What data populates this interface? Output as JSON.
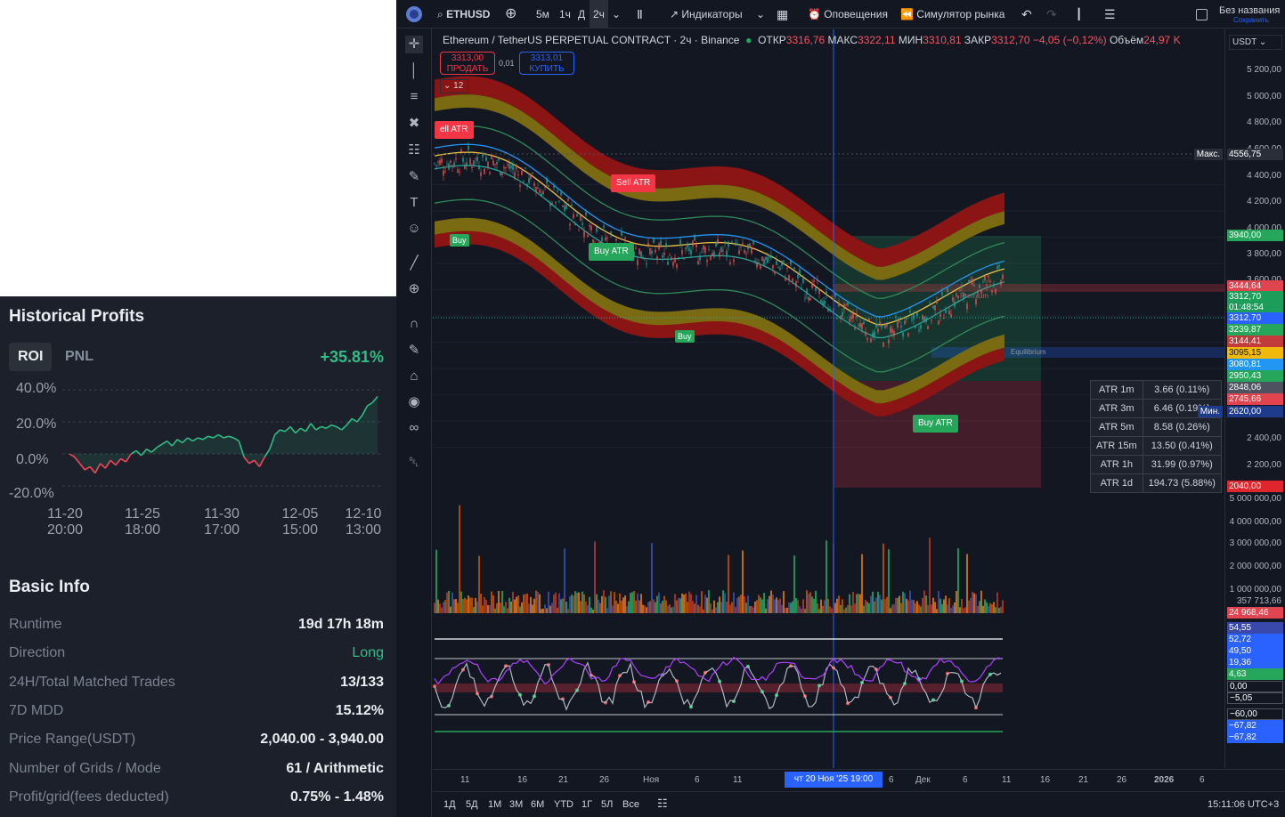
{
  "historical": {
    "title": "Historical Profits",
    "tabs": [
      "ROI",
      "PNL"
    ],
    "roi_value": "+35.81%",
    "y_ticks": [
      "40.0%",
      "20.0%",
      "0.0%",
      "-20.0%"
    ],
    "x_ticks": [
      {
        "date": "11-20",
        "time": "20:00"
      },
      {
        "date": "11-25",
        "time": "18:00"
      },
      {
        "date": "11-30",
        "time": "17:00"
      },
      {
        "date": "12-05",
        "time": "15:00"
      },
      {
        "date": "12-10",
        "time": "13:00"
      }
    ]
  },
  "chart_data": {
    "type": "line",
    "ylim": [
      -20,
      40
    ],
    "y_unit": "%",
    "x_range": [
      "11-20 20:00",
      "12-11"
    ],
    "values": [
      0,
      -2,
      -6,
      -10,
      -8,
      -12,
      -6,
      -9,
      -4,
      -7,
      -3,
      -5,
      0,
      2,
      -1,
      3,
      1,
      4,
      6,
      8,
      5,
      9,
      7,
      10,
      8,
      10,
      9,
      11,
      10,
      12,
      10,
      11,
      10,
      8,
      -2,
      -6,
      -4,
      -8,
      -2,
      3,
      12,
      15,
      14,
      17,
      13,
      16,
      14,
      19,
      15,
      17,
      16,
      18,
      17,
      15,
      18,
      22,
      20,
      24,
      30,
      32,
      35.81
    ],
    "line_colors": {
      "positive": "#2ebd85",
      "negative": "#f6465d"
    }
  },
  "basic_info": {
    "title": "Basic Info",
    "rows": [
      {
        "label": "Runtime",
        "value": "19d 17h 18m"
      },
      {
        "label": "Direction",
        "value": "Long"
      },
      {
        "label": "24H/Total Matched Trades",
        "value": "13/133"
      },
      {
        "label": "7D MDD",
        "value": "15.12%"
      },
      {
        "label": "Price Range(USDT)",
        "value": "2,040.00 - 3,940.00"
      },
      {
        "label": "Number of Grids / Mode",
        "value": "61 / Arithmetic"
      },
      {
        "label": "Profit/grid(fees deducted)",
        "value": "0.75% - 1.48%"
      }
    ]
  },
  "tv": {
    "symbol": "ETHUSD",
    "timeframes": [
      "5м",
      "1ч",
      "Д",
      "2ч"
    ],
    "active_timeframe": "2ч",
    "indicators_label": "Индикаторы",
    "alerts_label": "Оповещения",
    "replay_label": "Симулятор рынка",
    "layout_name": "Без названия",
    "save_label": "Сохранить",
    "title": "Ethereum / TetherUS PERPETUAL CONTRACT · 2ч · Binance",
    "ohlc": {
      "open_label": "ОТКР",
      "open": "3316,76",
      "high_label": "МАКС",
      "high": "3322,11",
      "low_label": "МИН",
      "low": "3310,81",
      "close_label": "ЗАКР",
      "close": "3312,70",
      "change": "−4,05 (−0,12%)",
      "volume_label": "Объём",
      "volume": "24,97 K"
    },
    "sell_price": "3313,00",
    "sell_label": "ПРОДАТЬ",
    "spread": "0,01",
    "buy_price": "3313,01",
    "buy_label": "КУПИТЬ",
    "indicator_count": "12",
    "currency": "USDT",
    "price_ticks": [
      "5 200,00",
      "5 000,00",
      "4 800,00",
      "4 600,00",
      "4 400,00",
      "4 200,00",
      "4 000,00",
      "3 800,00",
      "3 600,00",
      "2 400,00",
      "2 200,00"
    ],
    "price_tags": [
      {
        "label": "Макс.",
        "value": "4556,75",
        "color": "#2a2e39"
      },
      {
        "value": "3940,00",
        "color": "#26a65b"
      },
      {
        "value": "3444,64",
        "color": "#e0444f"
      },
      {
        "value": "3312,70",
        "color": "#1c9e5a"
      },
      {
        "value": "01:48:54",
        "color": "#1c9e5a"
      },
      {
        "value": "3312,70",
        "color": "#2962ff"
      },
      {
        "value": "3239,87",
        "color": "#26a65b"
      },
      {
        "value": "3144,41",
        "color": "#c23a3a"
      },
      {
        "value": "3095,15",
        "color": "#f0b90b"
      },
      {
        "value": "3080,81",
        "color": "#2196f3"
      },
      {
        "value": "2950,43",
        "color": "#26a65b"
      },
      {
        "value": "2848,06",
        "color": "#4e5260"
      },
      {
        "value": "2745,66",
        "color": "#e0444f"
      },
      {
        "label": "Мин.",
        "value": "2620,00",
        "color": "#1e3a8a"
      },
      {
        "value": "2040,00",
        "color": "#e0262d"
      }
    ],
    "volume_ticks": [
      "5 000 000,00",
      "4 000 000,00",
      "3 000 000,00",
      "2 000 000,00",
      "1 000 000,00",
      "357 713,66"
    ],
    "volume_tag": "24 968,46",
    "osc_tags": [
      {
        "value": "54,55",
        "color": "#3949ab"
      },
      {
        "value": "52,72",
        "color": "#2962ff"
      },
      {
        "value": "49,50",
        "color": "#2962ff"
      },
      {
        "value": "19,36",
        "color": "#2962ff"
      },
      {
        "value": "4,63",
        "color": "#26a65b"
      },
      {
        "value": "0,00",
        "color": "#131722"
      },
      {
        "value": "−5,05",
        "color": "#131722"
      },
      {
        "value": "−60,00",
        "color": "#131722"
      },
      {
        "value": "−67,82",
        "color": "#2962ff"
      },
      {
        "value": "−67,82",
        "color": "#2962ff"
      }
    ],
    "atr_table": [
      {
        "label": "ATR 1m",
        "value": "3.66 (0.11%)"
      },
      {
        "label": "ATR 3m",
        "value": "6.46 (0.19%)"
      },
      {
        "label": "ATR 5m",
        "value": "8.58 (0.26%)"
      },
      {
        "label": "ATR 15m",
        "value": "13.50 (0.41%)"
      },
      {
        "label": "ATR 1h",
        "value": "31.99 (0.97%)"
      },
      {
        "label": "ATR 1d",
        "value": "194.73 (5.88%)"
      }
    ],
    "signals": [
      {
        "text": "ell ATR",
        "type": "sell"
      },
      {
        "text": "Sell ATR",
        "type": "sell"
      },
      {
        "text": "Buy ATR",
        "type": "buy"
      },
      {
        "text": "Buy ATR",
        "type": "buy"
      },
      {
        "text": "Buy",
        "type": "buy"
      },
      {
        "text": "Buy",
        "type": "buy"
      }
    ],
    "zone_labels": [
      "Premium",
      "Equilibrium"
    ],
    "time_ticks": [
      "11",
      "16",
      "21",
      "26",
      "Ноя",
      "6",
      "11",
      "6",
      "Дек",
      "6",
      "11",
      "16",
      "21",
      "26",
      "2026",
      "6"
    ],
    "cursor_date": "чт 20 Ноя '25   19:00",
    "ranges": [
      "1Д",
      "5Д",
      "1М",
      "3М",
      "6М",
      "YTD",
      "1Г",
      "5Л",
      "Все"
    ],
    "clock": "15:11:06 UTC+3"
  }
}
